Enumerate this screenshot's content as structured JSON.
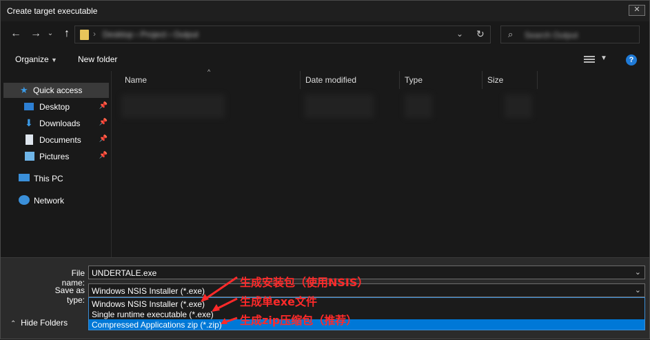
{
  "window": {
    "title": "Create target executable",
    "close_label": "✕"
  },
  "nav": {
    "back_icon": "back-arrow-icon",
    "forward_icon": "forward-arrow-icon",
    "up_icon": "up-arrow-icon",
    "address_path": "Desktop › Project › Output",
    "search_placeholder": "Search Output"
  },
  "toolbar": {
    "organize_label": "Organize",
    "new_folder_label": "New folder"
  },
  "sidebar": {
    "items": [
      {
        "label": "Quick access",
        "icon": "star-icon",
        "pinned": false
      },
      {
        "label": "Desktop",
        "icon": "desktop-icon",
        "pinned": true
      },
      {
        "label": "Downloads",
        "icon": "download-icon",
        "pinned": true
      },
      {
        "label": "Documents",
        "icon": "document-icon",
        "pinned": true
      },
      {
        "label": "Pictures",
        "icon": "picture-icon",
        "pinned": true
      },
      {
        "label": "This PC",
        "icon": "pc-icon",
        "pinned": false
      },
      {
        "label": "Network",
        "icon": "network-icon",
        "pinned": false
      }
    ]
  },
  "file_list": {
    "columns": [
      "Name",
      "Date modified",
      "Type",
      "Size"
    ]
  },
  "form": {
    "file_name_label": "File name:",
    "file_name_value": "UNDERTALE.exe",
    "save_as_label": "Save as type:",
    "save_as_value": "Windows NSIS Installer (*.exe)",
    "options": [
      "Windows NSIS Installer (*.exe)",
      "Single runtime executable (*.exe)",
      "Compressed Applications zip (*.zip)"
    ],
    "selected_option_index": 2,
    "hide_folders_label": "Hide Folders"
  },
  "annotations": [
    "生成安装包（使用NSIS）",
    "生成单exe文件",
    "生成zip压缩包（推荐）"
  ],
  "colors": {
    "accent": "#0078d7",
    "annotation": "#ff2a2a",
    "folder": "#e8c55a"
  }
}
